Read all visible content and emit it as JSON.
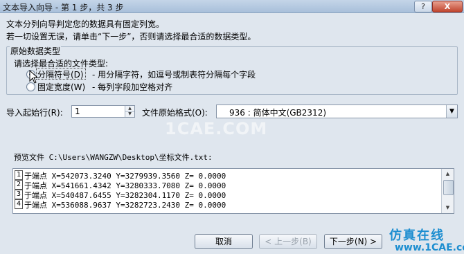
{
  "window": {
    "title": "文本导入向导 - 第 1 步，共 3 步",
    "help_label": "?",
    "close_label": "X"
  },
  "intro": {
    "line1": "文本分列向导判定您的数据具有固定列宽。",
    "line2": "若一切设置无误，请单击“下一步”，否则请选择最合适的数据类型。"
  },
  "original_type": {
    "group_title": "原始数据类型",
    "prompt": "请选择最合适的文件类型:",
    "options": [
      {
        "label": "分隔符号(D)",
        "description": "- 用分隔字符，如逗号或制表符分隔每个字段",
        "checked": true
      },
      {
        "label": "固定宽度(W)",
        "description": "- 每列字段加空格对齐",
        "checked": false
      }
    ]
  },
  "import_row": {
    "label": "导入起始行(R):",
    "value": "1"
  },
  "file_origin": {
    "label": "文件原始格式(O):",
    "value": "936 : 简体中文(GB2312)"
  },
  "watermark": "1CAE.COM",
  "preview": {
    "label": "预览文件 C:\\Users\\WANGZW\\Desktop\\坐标文件.txt:",
    "rows": [
      {
        "num": "1",
        "text": "       于端点  X=542073.3240  Y=3279939.3560  Z=   0.0000"
      },
      {
        "num": "2",
        "text": "       于端点  X=541661.4342  Y=3280333.7080  Z=   0.0000"
      },
      {
        "num": "3",
        "text": "       于端点  X=540487.6455  Y=3282304.1170  Z=   0.0000"
      },
      {
        "num": "4",
        "text": "       于端点  X=536088.9637  Y=3282723.2430  Z=   0.0000"
      }
    ]
  },
  "buttons": {
    "cancel": "取消",
    "back": "< 上一步(B)",
    "next": "下一步(N) >"
  },
  "logo": {
    "main": "仿真在线",
    "sub": "www.1CAE.com"
  },
  "colors": {
    "dialog_bg": "#dfe6ee",
    "logo_blue": "#1d8ed0"
  }
}
